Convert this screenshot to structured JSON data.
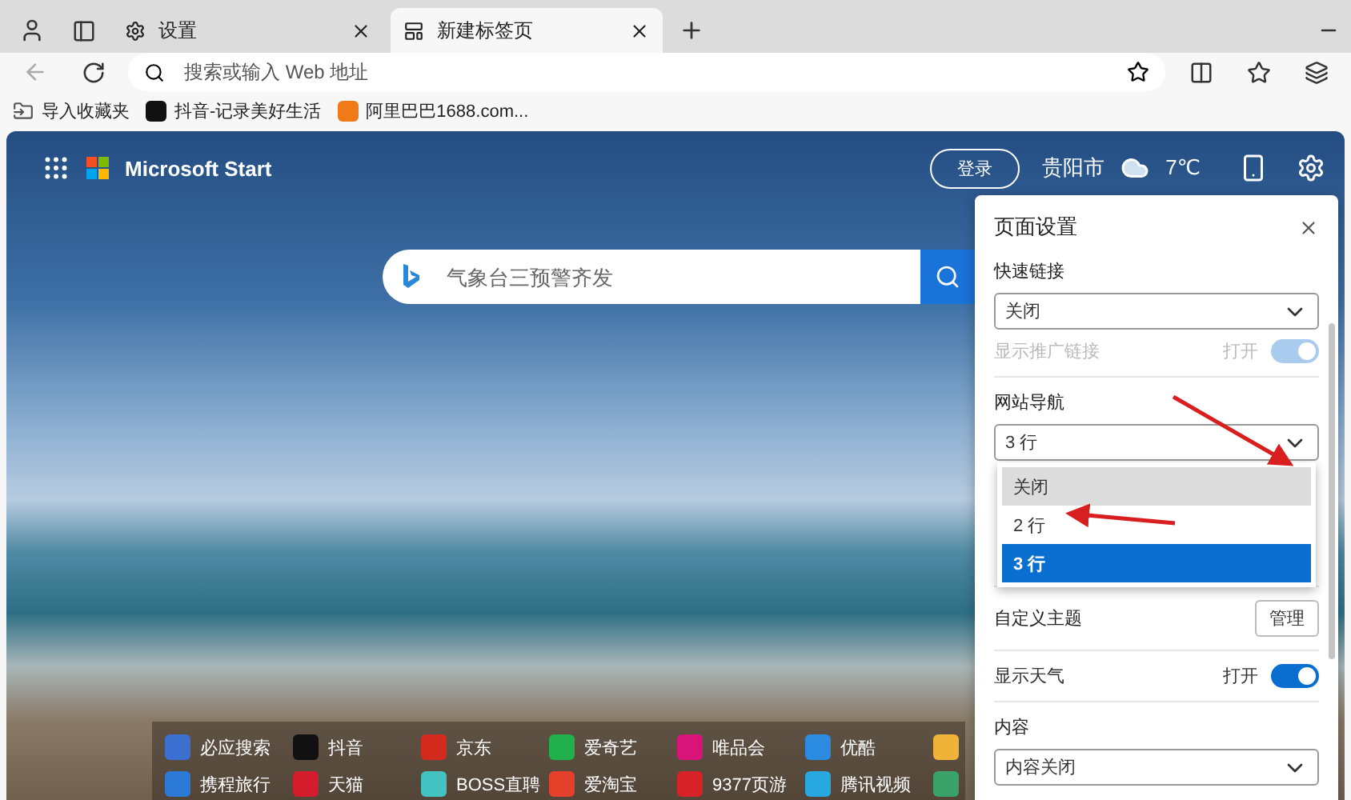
{
  "tabs": [
    {
      "label": "设置",
      "selected": false
    },
    {
      "label": "新建标签页",
      "selected": true
    }
  ],
  "address_bar": {
    "placeholder": "搜索或输入 Web 地址"
  },
  "favorites": [
    {
      "label": "导入收藏夹"
    },
    {
      "label": "抖音-记录美好生活"
    },
    {
      "label": "阿里巴巴1688.com..."
    }
  ],
  "start": {
    "brand": "Microsoft Start",
    "sign_in": "登录",
    "city": "贵阳市",
    "temperature": "7℃"
  },
  "search": {
    "placeholder": "气象台三预警齐发"
  },
  "quick_links": [
    [
      {
        "label": "必应搜索",
        "color": "#3b6fd0"
      },
      {
        "label": "抖音",
        "color": "#111111"
      },
      {
        "label": "京东",
        "color": "#d42a1e"
      },
      {
        "label": "爱奇艺",
        "color": "#21b04b"
      },
      {
        "label": "唯品会",
        "color": "#d8137a"
      },
      {
        "label": "优酷",
        "color": "#2a8be0"
      },
      {
        "color": "#f0b33a"
      }
    ],
    [
      {
        "label": "携程旅行",
        "color": "#2b7ad8"
      },
      {
        "label": "天猫",
        "color": "#d41c2c"
      },
      {
        "label": "BOSS直聘",
        "color": "#43c2c2"
      },
      {
        "label": "爱淘宝",
        "color": "#e4402a"
      },
      {
        "label": "9377页游",
        "color": "#d8222a"
      },
      {
        "label": "腾讯视频",
        "color": "#28a8e0"
      },
      {
        "color": "#3aa36a"
      }
    ]
  ],
  "panel": {
    "title": "页面设置",
    "sections": [
      {
        "kind": "select",
        "title": "快速链接",
        "value": "关闭",
        "expanded": false,
        "toggle": {
          "label": "显示推广链接",
          "state": "打开",
          "on": true,
          "disabled": true
        }
      },
      {
        "kind": "select",
        "title": "网站导航",
        "value": "3 行",
        "expanded": true,
        "options": [
          {
            "label": "关闭",
            "selected": false,
            "highlighted": true
          },
          {
            "label": "2 行",
            "selected": false,
            "highlighted": false
          },
          {
            "label": "3 行",
            "selected": true,
            "highlighted": false
          }
        ]
      },
      {
        "kind": "button",
        "title": "自定义主题",
        "button": "管理"
      },
      {
        "kind": "toggle",
        "title": "显示天气",
        "state": "打开",
        "on": true,
        "disabled": false
      },
      {
        "kind": "select",
        "title": "内容",
        "value": "内容关闭"
      }
    ]
  }
}
